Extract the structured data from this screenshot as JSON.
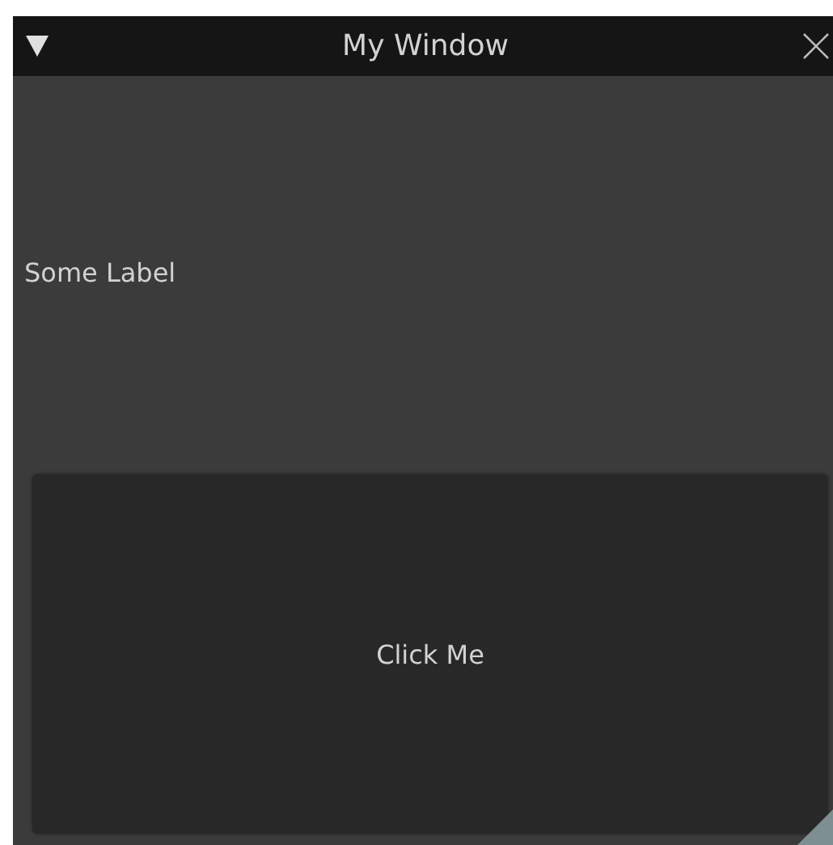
{
  "window": {
    "title": "My Window"
  },
  "label": "Some Label",
  "button": {
    "label": "Click Me"
  }
}
